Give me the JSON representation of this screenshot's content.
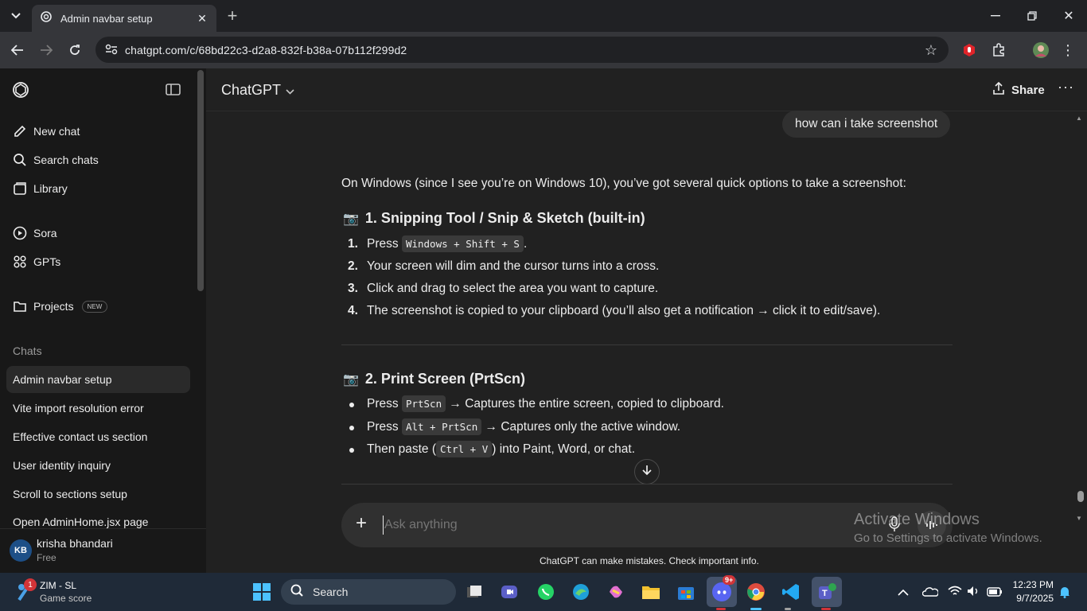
{
  "browser": {
    "tab_title": "Admin navbar setup",
    "url": "chatgpt.com/c/68bd22c3-d2a8-832f-b38a-07b112f299d2"
  },
  "sidebar": {
    "nav_items": [
      {
        "label": "New chat",
        "icon": "new-chat-icon"
      },
      {
        "label": "Search chats",
        "icon": "search-icon"
      },
      {
        "label": "Library",
        "icon": "library-icon"
      },
      {
        "label": "Sora",
        "icon": "sora-icon"
      },
      {
        "label": "GPTs",
        "icon": "gpts-icon"
      },
      {
        "label": "Projects",
        "icon": "projects-icon",
        "badge": "NEW"
      }
    ],
    "chats_header": "Chats",
    "chats": [
      "Admin navbar setup",
      "Vite import resolution error",
      "Effective contact us section",
      "User identity inquiry",
      "Scroll to sections setup",
      "Open AdminHome.jsx page"
    ],
    "user": {
      "initials": "KB",
      "name": "krisha bhandari",
      "plan": "Free"
    }
  },
  "header": {
    "model_name": "ChatGPT",
    "share_label": "Share"
  },
  "conversation": {
    "user_message": "how can i take screenshot",
    "intro": "On Windows (since I see you’re on Windows 10), you’ve got several quick options to take a screenshot:",
    "section1": {
      "emoji": "📷",
      "title": "1. Snipping Tool / Snip & Sketch (built-in)",
      "items": [
        {
          "num": "1.",
          "pre": "Press ",
          "code": "Windows + Shift + S",
          "post": "."
        },
        {
          "num": "2.",
          "pre": "Your screen will dim and the cursor turns into a cross.",
          "code": "",
          "post": ""
        },
        {
          "num": "3.",
          "pre": "Click and drag to select the area you want to capture.",
          "code": "",
          "post": ""
        },
        {
          "num": "4.",
          "pre": "The screenshot is copied to your clipboard (you’ll also get a notification → click it to edit/save).",
          "code": "",
          "post": ""
        }
      ]
    },
    "section2": {
      "emoji": "📷",
      "title": "2. Print Screen (PrtScn)",
      "items": [
        {
          "pre": "Press ",
          "code": "PrtScn",
          "post": " → Captures the entire screen, copied to clipboard."
        },
        {
          "pre": "Press ",
          "code": "Alt + PrtScn",
          "post": " → Captures only the active window."
        },
        {
          "pre": "Then paste (",
          "code": "Ctrl + V",
          "post": ") into Paint, Word, or chat."
        }
      ]
    }
  },
  "composer": {
    "placeholder": "Ask anything",
    "disclaimer": "ChatGPT can make mistakes. Check important info."
  },
  "watermark": {
    "line1": "Activate Windows",
    "line2": "Go to Settings to activate Windows."
  },
  "taskbar": {
    "widget_title": "ZIM - SL",
    "widget_subtitle": "Game score",
    "widget_badge": "1",
    "search_label": "Search",
    "discord_badge": "9+",
    "time": "12:23 PM",
    "date": "9/7/2025"
  }
}
